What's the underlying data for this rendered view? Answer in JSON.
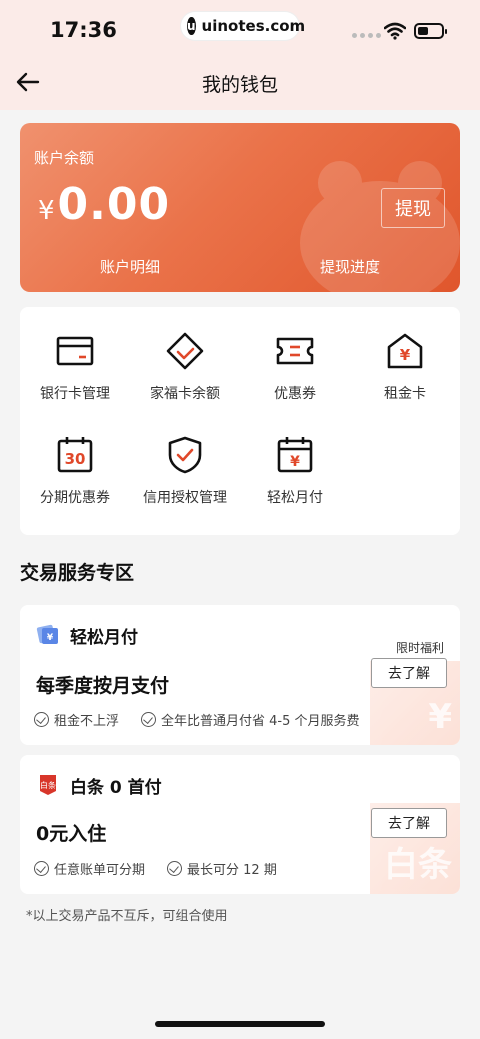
{
  "status_bar": {
    "time": "17:36",
    "site": "uinotes.com",
    "site_badge": "u"
  },
  "nav": {
    "title": "我的钱包"
  },
  "balance": {
    "label": "账户余额",
    "currency": "¥",
    "amount": "0.00",
    "withdraw_label": "提现",
    "links": [
      "账户明细",
      "提现进度"
    ]
  },
  "services": [
    {
      "label": "银行卡管理",
      "icon": "bank-card-icon"
    },
    {
      "label": "家福卡余额",
      "icon": "diamond-check-icon"
    },
    {
      "label": "优惠券",
      "icon": "coupon-icon"
    },
    {
      "label": "租金卡",
      "icon": "rent-card-icon"
    },
    {
      "label": "分期优惠券",
      "icon": "calendar-30-icon"
    },
    {
      "label": "信用授权管理",
      "icon": "shield-check-icon"
    },
    {
      "label": "轻松月付",
      "icon": "calendar-yuan-icon"
    }
  ],
  "icon_glyphs": {
    "thirty": "30",
    "yuan": "¥"
  },
  "section": {
    "title": "交易服务专区"
  },
  "cards": [
    {
      "name": "轻松月付",
      "tag": "限时福利",
      "headline": "每季度按月支付",
      "button": "去了解",
      "features": [
        "租金不上浮",
        "全年比普通月付省 4-5 个月服务费"
      ],
      "watermark": "¥"
    },
    {
      "name": "白条 0 首付",
      "icon_text": "白条",
      "headline": "0元入住",
      "button": "去了解",
      "features": [
        "任意账单可分期",
        "最长可分 12 期"
      ],
      "watermark": "白条"
    }
  ],
  "footnote": "*以上交易产品不互斥，可组合使用",
  "colors": {
    "accent": "#e8653c",
    "icon_red": "#e0482a"
  }
}
